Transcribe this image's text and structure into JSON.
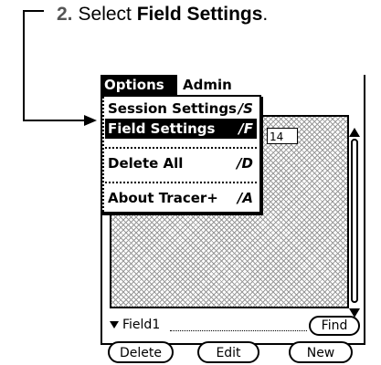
{
  "instruction": {
    "number": "2.",
    "prefix": "Select ",
    "target": "Field Settings",
    "suffix": "."
  },
  "menubar": {
    "active_menu": "Options",
    "other_menu": "Admin"
  },
  "menu_items": [
    {
      "label": "Session Settings",
      "shortcut": "/S"
    },
    {
      "label": "Field Settings",
      "shortcut": "/F"
    },
    {
      "label": "Delete All",
      "shortcut": "/D"
    },
    {
      "label": "About Tracer+",
      "shortcut": "/A"
    }
  ],
  "list_field_value": "14",
  "field_row": {
    "label": "Field1",
    "find_label": "Find"
  },
  "buttons": {
    "delete": "Delete",
    "edit": "Edit",
    "new": "New"
  }
}
